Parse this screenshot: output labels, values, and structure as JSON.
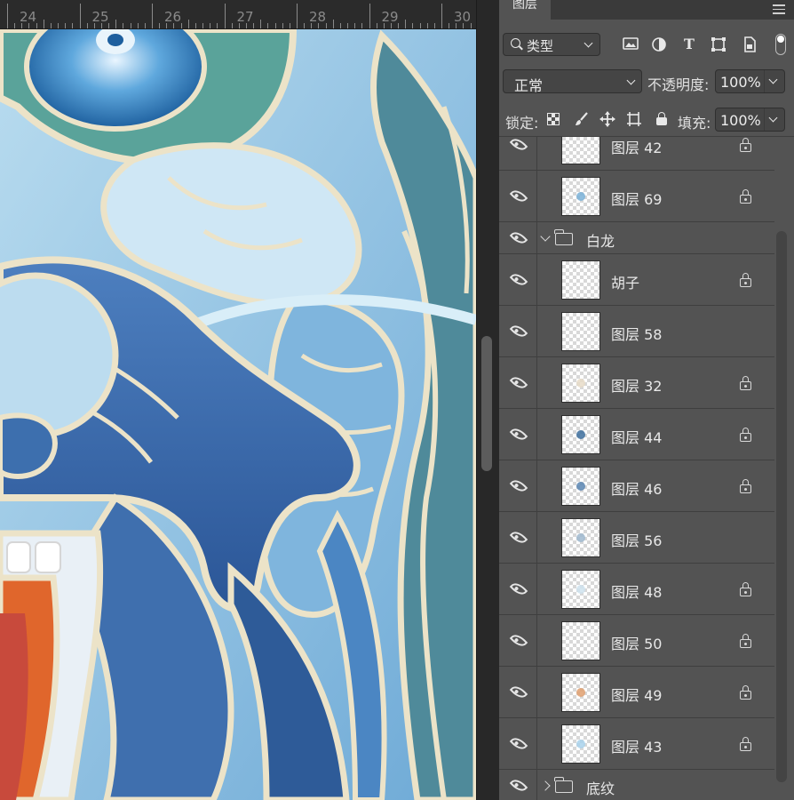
{
  "ruler": {
    "labels": [
      "24",
      "25",
      "26",
      "27",
      "28",
      "29",
      "30"
    ]
  },
  "canvas": {
    "description_colors": {
      "sky": "#9cc9e0",
      "outline": "#ece3c8",
      "deep_blue": "#3f6fae",
      "teal": "#5aa39a",
      "orange": "#e0662c"
    }
  },
  "panel": {
    "tab": "图层",
    "filter": {
      "label": "类型",
      "icons": [
        "image-filter-icon",
        "adjustment-filter-icon",
        "type-filter-icon",
        "shape-filter-icon",
        "smart-object-filter-icon"
      ]
    },
    "blend": {
      "mode": "正常",
      "opacity_label": "不透明度:",
      "opacity_value": "100%"
    },
    "lock": {
      "label": "锁定:",
      "fill_label": "填充:",
      "fill_value": "100%"
    },
    "layers": [
      {
        "name": "图层 42",
        "locked": true,
        "mark": ""
      },
      {
        "name": "图层 69",
        "locked": true,
        "mark": "#7ab2d8"
      },
      {
        "name": "白龙",
        "group": true,
        "expanded": true
      },
      {
        "name": "胡子",
        "locked": true,
        "mark": ""
      },
      {
        "name": "图层 58",
        "locked": false,
        "mark": ""
      },
      {
        "name": "图层 32",
        "locked": true,
        "mark": "#e8dcc8"
      },
      {
        "name": "图层 44",
        "locked": true,
        "mark": "#3d6f9e"
      },
      {
        "name": "图层 46",
        "locked": true,
        "mark": "#5a86b3"
      },
      {
        "name": "图层 56",
        "locked": false,
        "mark": "#9fb8cf"
      },
      {
        "name": "图层 48",
        "locked": true,
        "mark": "#cfe3ee"
      },
      {
        "name": "图层 50",
        "locked": true,
        "mark": ""
      },
      {
        "name": "图层 49",
        "locked": true,
        "mark": "#e0a070"
      },
      {
        "name": "图层 43",
        "locked": true,
        "mark": "#a9d2ec"
      },
      {
        "name": "底纹",
        "group": true,
        "expanded": false
      }
    ]
  }
}
